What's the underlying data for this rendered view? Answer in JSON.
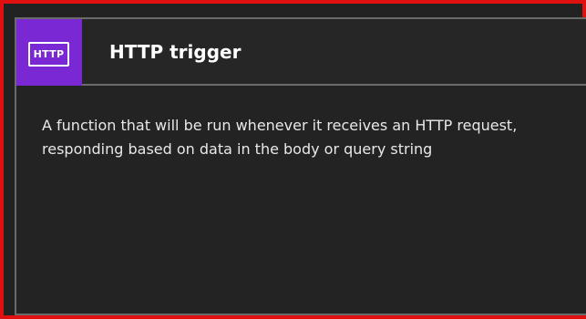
{
  "template_card": {
    "icon_text": "HTTP",
    "title": "HTTP trigger",
    "description": "A function that will be run whenever it receives an HTTP request, responding based on data in the body or query string"
  },
  "colors": {
    "highlight_border": "#e01010",
    "icon_tile": "#7a28d4",
    "card_background": "#232323",
    "card_border": "#6a6a6a",
    "text": "#ffffff"
  },
  "icons": {
    "http_icon": "http-icon"
  }
}
